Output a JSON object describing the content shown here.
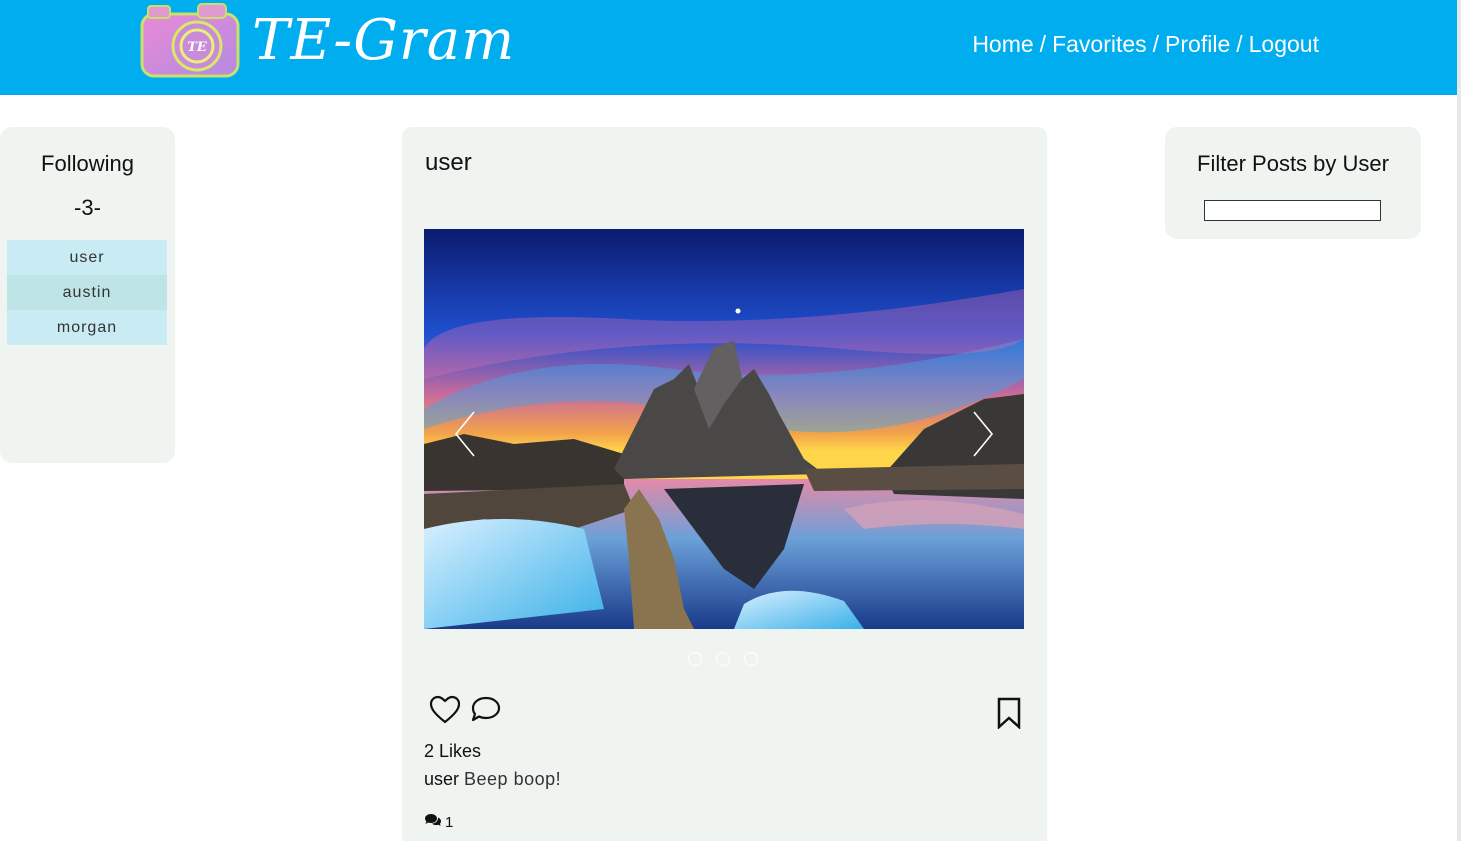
{
  "header": {
    "brand": "TE-Gram",
    "logo_text": "TE",
    "nav": {
      "home": "Home",
      "favorites": "Favorites",
      "profile": "Profile",
      "logout": "Logout",
      "separator": "/"
    },
    "bg_color": "#00adef"
  },
  "following": {
    "title": "Following",
    "count": "-3-",
    "users": [
      "user",
      "austin",
      "morgan"
    ]
  },
  "post": {
    "username": "user",
    "image_icon": "mountain-lake-photo",
    "slides": 3,
    "active_slide": 1,
    "likes": "2 Likes",
    "caption_user": "user",
    "caption_text": "Beep boop!",
    "comment_count": "1"
  },
  "filter": {
    "title": "Filter Posts by User",
    "placeholder": ""
  }
}
